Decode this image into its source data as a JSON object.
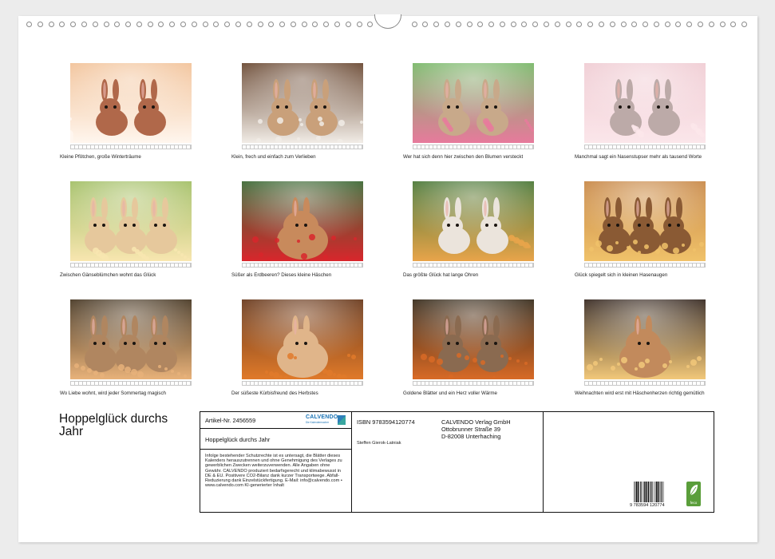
{
  "calendar": {
    "title": "Hoppelglück durchs Jahr",
    "months": [
      {
        "caption": "Kleine Pfötchen, große Winterträume",
        "scene": "snow-bunnies",
        "palette": [
          "#f2c39a",
          "#b0684a",
          "#fff6ee"
        ]
      },
      {
        "caption": "Klein, frech und einfach zum Verlieben",
        "scene": "snow-duo",
        "palette": [
          "#6b4a34",
          "#c9a07a",
          "#f1ece6"
        ]
      },
      {
        "caption": "Wer hat sich denn hier zwischen den Blumen versteckt",
        "scene": "tulip-bunnies",
        "palette": [
          "#7ab96a",
          "#c8a98a",
          "#e77a9c"
        ]
      },
      {
        "caption": "Manchmal sagt ein Nasenstupser mehr als tausend Worte",
        "scene": "kiss-bunnies",
        "palette": [
          "#f0cdd4",
          "#bcaaa8",
          "#fbe6ea"
        ]
      },
      {
        "caption": "Zwischen Gänseblümchen wohnt das Glück",
        "scene": "daisy-bunnies",
        "palette": [
          "#a4c068",
          "#e6c89c",
          "#f8e6b0"
        ]
      },
      {
        "caption": "Süßer als Erdbeeren? Dieses kleine Häschen",
        "scene": "strawberry-bunny",
        "palette": [
          "#3e6a36",
          "#c88a5c",
          "#d8262c"
        ]
      },
      {
        "caption": "Das größte Glück hat lange Ohren",
        "scene": "flower-family",
        "palette": [
          "#4d7a3a",
          "#ebe4dc",
          "#e8a44a"
        ]
      },
      {
        "caption": "Glück spiegelt sich in kleinen Hasenaugen",
        "scene": "reflection-bunnies",
        "palette": [
          "#c98a4a",
          "#8a5a34",
          "#f0c26a"
        ]
      },
      {
        "caption": "Wo Liebe wohnt, wird jeder Sommertag magisch",
        "scene": "summer-trio",
        "palette": [
          "#4a3a26",
          "#b08660",
          "#e8b27a"
        ]
      },
      {
        "caption": "Der süßeste Kürbisfreund des Herbstes",
        "scene": "pumpkin-bunny",
        "palette": [
          "#6b3b1e",
          "#e0b58a",
          "#e07a2a"
        ]
      },
      {
        "caption": "Goldene Blätter und ein Herz voller Wärme",
        "scene": "autumn-bunnies",
        "palette": [
          "#3a2e1e",
          "#8a6a50",
          "#d86a26"
        ]
      },
      {
        "caption": "Weihnachten wird erst mit Häschenherzen richtig gemütlich",
        "scene": "christmas-bunny",
        "palette": [
          "#3a2c24",
          "#c28a5c",
          "#f2c87a"
        ]
      }
    ]
  },
  "info": {
    "article_label": "Artikel-Nr. 2456559",
    "product_title": "Hoppelglück durchs Jahr",
    "logo_name": "CALVENDO",
    "logo_tagline": "Die Kalendermacher",
    "legal_text": "Infolge bestehender Schutzrechte ist es untersagt, die Blätter dieses Kalenders herauszutrennen und ohne Genehmigung des Verlages zu gewerblichen Zwecken weiterzuverwenden. Alle Angaben ohne Gewähr. CALVENDO produziert bedarfsgerecht und klimabewusst in DE & EU. Positivere CO2-Bilanz dank kurzer Transportwege. Abfall-Reduzierung dank Einzelstückfertigung. E-Mail: info@calvendo.com • www.calvendo.com KI-generierter Inhalt",
    "isbn": "ISBN 9783594120774",
    "author": "Steffen Gierok-Latniak",
    "publisher_name": "CALVENDO Verlag GmbH",
    "publisher_street": "Ottobrunner Straße 39",
    "publisher_city": "D-82008 Unterhaching",
    "barcode_number": "9 783594 120774",
    "eco_label": "feco"
  }
}
